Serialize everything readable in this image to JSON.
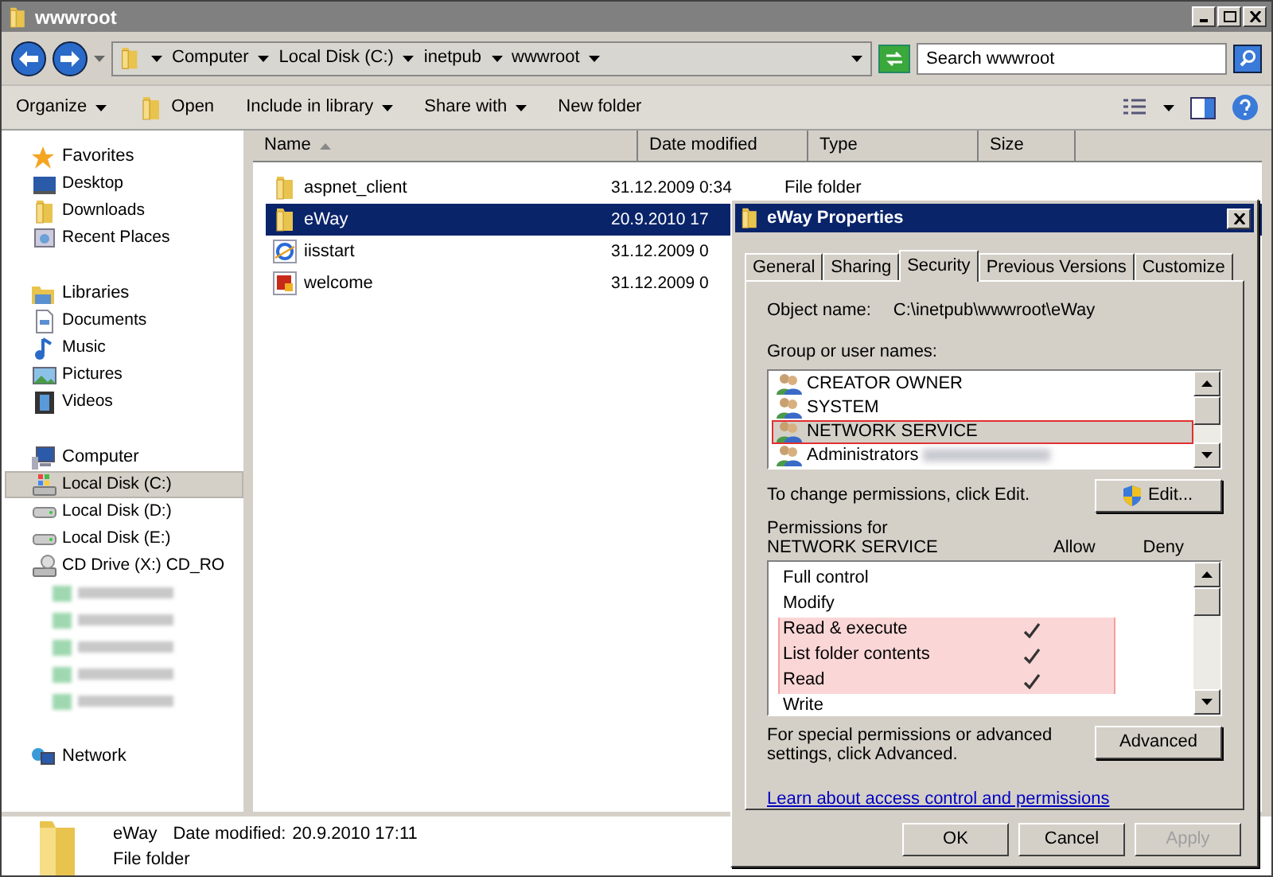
{
  "window": {
    "title": "wwwroot"
  },
  "address_bar": {
    "segments": [
      "Computer",
      "Local Disk (C:)",
      "inetpub",
      "wwwroot"
    ],
    "search": {
      "placeholder": "Search wwwroot"
    }
  },
  "toolbar": [
    {
      "label": "Organize",
      "kind": "menu"
    },
    {
      "label": "Open",
      "kind": "icon"
    },
    {
      "label": "Include in library",
      "kind": "menu"
    },
    {
      "label": "Share with",
      "kind": "menu"
    },
    {
      "label": "New folder",
      "kind": "plain"
    }
  ],
  "sidebar": {
    "groups": [
      {
        "label": "Favorites",
        "kind": "star",
        "children": [
          {
            "label": "Desktop",
            "kind": "desktop",
            "selected": false
          },
          {
            "label": "Downloads",
            "kind": "folder",
            "selected": false
          },
          {
            "label": "Recent Places",
            "kind": "recent",
            "selected": false
          }
        ]
      },
      {
        "label": "Libraries",
        "kind": "library",
        "children": [
          {
            "label": "Documents",
            "kind": "doc",
            "selected": false
          },
          {
            "label": "Music",
            "kind": "music",
            "selected": false
          },
          {
            "label": "Pictures",
            "kind": "picture",
            "selected": false
          },
          {
            "label": "Videos",
            "kind": "video",
            "selected": false
          }
        ]
      },
      {
        "label": "Computer",
        "kind": "computer",
        "children": [
          {
            "label": "Local Disk (C:)",
            "kind": "sysdisk",
            "selected": true
          },
          {
            "label": "Local Disk (D:)",
            "kind": "disk",
            "selected": false
          },
          {
            "label": "Local Disk (E:)",
            "kind": "disk",
            "selected": false
          },
          {
            "label": "CD Drive (X:) CD_RO",
            "kind": "cd",
            "selected": false
          },
          {
            "kind": "blurred"
          },
          {
            "kind": "blurred"
          },
          {
            "kind": "blurred"
          },
          {
            "kind": "blurred"
          },
          {
            "kind": "blurred"
          }
        ]
      },
      {
        "label": "Network",
        "kind": "network"
      }
    ]
  },
  "table": {
    "columns": [
      {
        "label": "Name",
        "sorted": true
      },
      {
        "label": "Date modified",
        "sorted": false
      },
      {
        "label": "Type",
        "sorted": false
      },
      {
        "label": "Size",
        "sorted": false
      }
    ],
    "rows": [
      {
        "name": "aspnet_client",
        "kind": "folder",
        "date": "31.12.2009 0:34",
        "type": "File folder",
        "selected": false
      },
      {
        "name": "eWay",
        "kind": "folder",
        "date": "20.9.2010 17",
        "selected": true
      },
      {
        "name": "iisstart",
        "kind": "html",
        "date": "31.12.2009 0",
        "selected": false
      },
      {
        "name": "welcome",
        "kind": "image",
        "date": "31.12.2009 0",
        "selected": false
      }
    ]
  },
  "details_pane": {
    "name": "eWay",
    "date_label": "Date modified:",
    "date": "20.9.2010 17:11",
    "type": "File folder"
  },
  "dialog": {
    "title": "eWay Properties",
    "tabs": [
      {
        "label": "General",
        "selected": false
      },
      {
        "label": "Sharing",
        "selected": false
      },
      {
        "label": "Security",
        "selected": true
      },
      {
        "label": "Previous Versions",
        "selected": false
      },
      {
        "label": "Customize",
        "selected": false
      }
    ],
    "object_name_label": "Object name:",
    "object_name": "C:\\inetpub\\wwwroot\\eWay",
    "group_label": "Group or user names:",
    "users": [
      {
        "name": "CREATOR OWNER",
        "selected": false,
        "highlighted": false,
        "redacted": false
      },
      {
        "name": "SYSTEM",
        "selected": false,
        "highlighted": false,
        "redacted": false
      },
      {
        "name": "NETWORK SERVICE",
        "selected": true,
        "highlighted": true,
        "redacted": false
      },
      {
        "name": "Administrators",
        "selected": false,
        "highlighted": false,
        "redacted": true
      }
    ],
    "change_hint": "To change permissions, click Edit.",
    "edit_button": "Edit...",
    "permissions_label": "Permissions for NETWORK SERVICE",
    "allow_label": "Allow",
    "deny_label": "Deny",
    "permissions": [
      {
        "name": "Full control",
        "allow": false,
        "deny": false,
        "highlighted": false
      },
      {
        "name": "Modify",
        "allow": false,
        "deny": false,
        "highlighted": false
      },
      {
        "name": "Read & execute",
        "allow": true,
        "deny": false,
        "highlighted": true
      },
      {
        "name": "List folder contents",
        "allow": true,
        "deny": false,
        "highlighted": true
      },
      {
        "name": "Read",
        "allow": true,
        "deny": false,
        "highlighted": true
      },
      {
        "name": "Write",
        "allow": false,
        "deny": false,
        "highlighted": false
      }
    ],
    "advanced_hint": "For special permissions or advanced settings, click Advanced.",
    "advanced_button": "Advanced",
    "link": "Learn about access control and permissions",
    "buttons": [
      {
        "label": "OK",
        "disabled": false
      },
      {
        "label": "Cancel",
        "disabled": false
      },
      {
        "label": "Apply",
        "disabled": true
      }
    ]
  }
}
